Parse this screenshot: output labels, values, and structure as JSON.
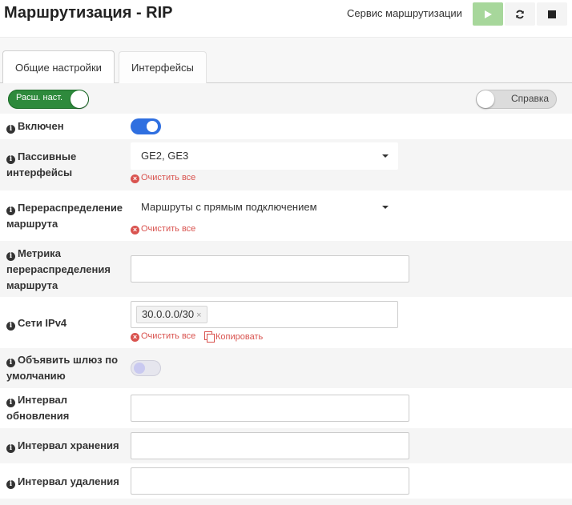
{
  "header": {
    "title": "Маршрутизация - RIP",
    "service_label": "Сервис маршрутизации",
    "buttons": {
      "start": "play-icon",
      "restart": "reload-icon",
      "stop": "stop-icon"
    },
    "start_color": "#a7d79b"
  },
  "tabs": [
    {
      "label": "Общие настройки",
      "active": true
    },
    {
      "label": "Интерфейсы",
      "active": false
    }
  ],
  "toolbar": {
    "advanced_label": "Расш. наст.",
    "advanced_on": true,
    "help_label": "Справка",
    "help_on": false
  },
  "form": {
    "enabled": {
      "label": "Включен",
      "value": true
    },
    "passive": {
      "label": "Пассивные интерфейсы",
      "value": "GE2, GE3",
      "clear": "Очистить все"
    },
    "redistribute": {
      "label": "Перераспределение маршрута",
      "value": "Маршруты с прямым подключением",
      "clear": "Очистить все"
    },
    "metric": {
      "label": "Метрика перераспределения маршрута",
      "value": ""
    },
    "networks": {
      "label": "Сети IPv4",
      "tags": [
        "30.0.0.0/30"
      ],
      "clear": "Очистить все",
      "copy": "Копировать"
    },
    "default_gw": {
      "label": "Объявить шлюз по умолчанию",
      "value": false
    },
    "update_interval": {
      "label": "Интервал обновления",
      "value": ""
    },
    "hold_interval": {
      "label": "Интервал хранения",
      "value": ""
    },
    "flush_interval": {
      "label": "Интервал удаления",
      "value": ""
    }
  },
  "colors": {
    "accent": "#2f6fe0",
    "danger": "#d9534f",
    "success": "#2e8a3c"
  }
}
